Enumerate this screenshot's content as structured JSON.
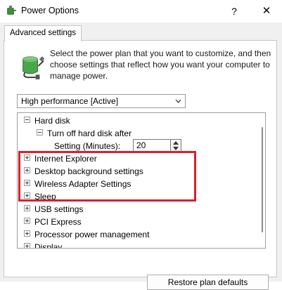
{
  "window": {
    "title": "Power Options",
    "help_label": "?",
    "close_label": "✕"
  },
  "tab": {
    "label": "Advanced settings"
  },
  "description": "Select the power plan that you want to customize, and then choose settings that reflect how you want your computer to manage power.",
  "plan_select": {
    "value": "High performance [Active]"
  },
  "tree": {
    "items": [
      {
        "label": "Hard disk",
        "state": "expanded"
      },
      {
        "label": "Turn off hard disk after",
        "state": "expanded"
      },
      {
        "label": "Setting (Minutes):",
        "value": "20"
      },
      {
        "label": "Internet Explorer",
        "state": "collapsed"
      },
      {
        "label": "Desktop background settings",
        "state": "collapsed"
      },
      {
        "label": "Wireless Adapter Settings",
        "state": "collapsed"
      },
      {
        "label": "Sleep",
        "state": "collapsed"
      },
      {
        "label": "USB settings",
        "state": "collapsed"
      },
      {
        "label": "PCI Express",
        "state": "collapsed"
      },
      {
        "label": "Processor power management",
        "state": "collapsed"
      },
      {
        "label": "Display",
        "state": "collapsed"
      }
    ]
  },
  "buttons": {
    "restore": "Restore plan defaults"
  },
  "icons": {
    "app": "power-options-icon",
    "plan": "battery-plug-icon",
    "dropdown": "chevron-down-icon",
    "spin_up": "spin-up-icon",
    "spin_down": "spin-down-icon"
  },
  "colors": {
    "highlight": "#d9202b",
    "window_bg": "#f0f0f0"
  }
}
